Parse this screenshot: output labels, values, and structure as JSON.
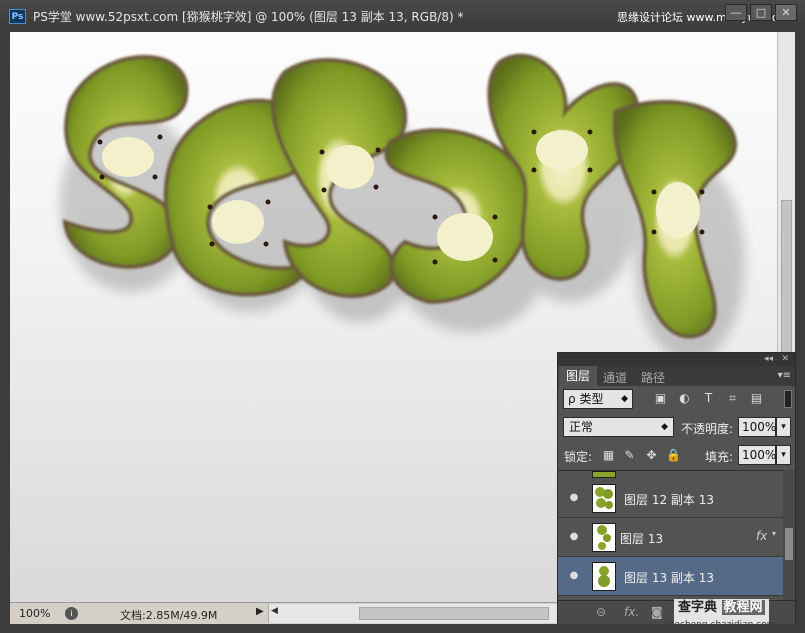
{
  "app": {
    "logo": "Ps",
    "title": "PS学堂 www.52psxt.com [猕猴桃字效] @ 100% (图层 13 副本 13, RGB/8) *",
    "watermark": "思缘设计论坛 www.missyuan.com"
  },
  "window": {
    "minimize": "—",
    "maximize": "□",
    "close": "✕"
  },
  "status": {
    "zoom": "100%",
    "doc_size": "文档:2.85M/49.9M"
  },
  "layers_panel": {
    "tabs": [
      {
        "label": "图层",
        "active": true
      },
      {
        "label": "通道",
        "active": false
      },
      {
        "label": "路径",
        "active": false
      }
    ],
    "filter_kind": "类型",
    "blend_mode": "正常",
    "opacity_label": "不透明度:",
    "opacity_value": "100%",
    "lock_label": "锁定:",
    "fill_label": "填充:",
    "fill_value": "100%",
    "layers": [
      {
        "name": "图层 12 副本 13",
        "fx": false,
        "selected": false
      },
      {
        "name": "图层 13",
        "fx": true,
        "selected": false
      },
      {
        "name": "图层 13 副本 13",
        "fx": false,
        "selected": true
      }
    ],
    "fx_label": "fx"
  },
  "footer_logo": {
    "main": "查字典",
    "badge": "教程网",
    "sub": "jiaocheng.chazidian.com"
  },
  "colors": {
    "kiwi_skin": "#6e5a3a",
    "kiwi_flesh": "#8aa32a",
    "kiwi_core": "#f1f0c6",
    "selected_layer": "#546a86"
  }
}
